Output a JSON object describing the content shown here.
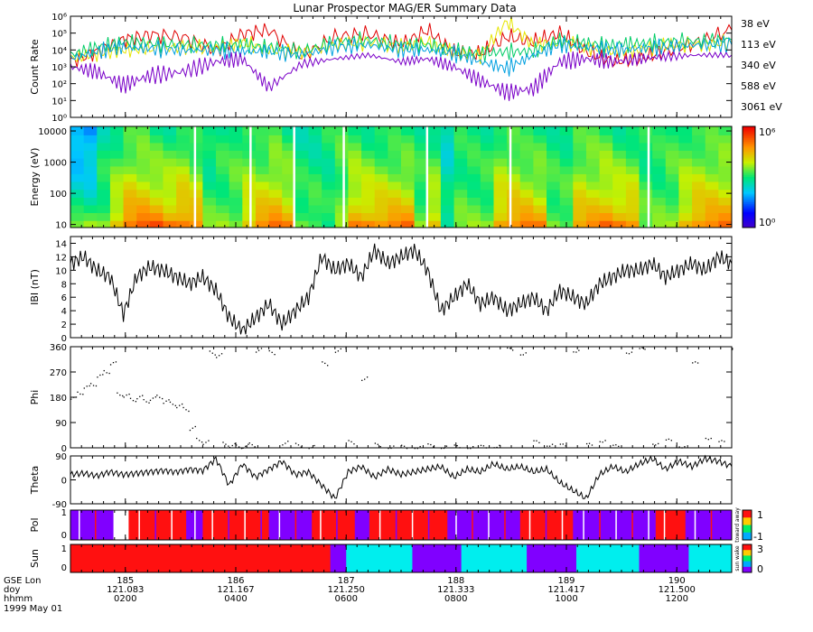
{
  "title": "Lunar Prospector MAG/ER Summary Data",
  "colors": {
    "axis": "#000000",
    "trace": "#000000",
    "ch38": "#e00000",
    "ch113": "#e6e600",
    "ch340": "#00cc66",
    "ch588": "#00a0e0",
    "ch3061": "#7a00c8",
    "pol_pos": "#ff1010",
    "pol_neg": "#8000ff",
    "sun_0": "#ffffff",
    "sun_1": "#8000ff",
    "sun_2": "#00eeee",
    "sun_3": "#ff1010"
  },
  "chart_data": [
    {
      "type": "line",
      "panel": "count-rate",
      "ylabel": "Count Rate",
      "yscale": "log",
      "ylim": [
        1,
        1000000
      ],
      "yticks": [
        "10⁰",
        "10¹",
        "10²",
        "10³",
        "10⁴",
        "10⁵",
        "10⁶"
      ],
      "xlim": [
        0,
        1
      ],
      "series": [
        {
          "name": "38 eV",
          "color": "#e00000",
          "x": [
            0.0,
            0.04,
            0.08,
            0.12,
            0.17,
            0.22,
            0.26,
            0.3,
            0.35,
            0.4,
            0.45,
            0.5,
            0.54,
            0.58,
            0.62,
            0.66,
            0.7,
            0.74,
            0.78,
            0.82,
            0.86,
            0.9,
            0.95,
            1.0
          ],
          "y": [
            2000,
            8000,
            40000,
            80000,
            60000,
            9000,
            90000,
            150000,
            4000,
            60000,
            90000,
            20000,
            150000,
            7000,
            6000,
            60000,
            30000,
            100000,
            8000,
            2000,
            3000,
            8000,
            30000,
            150000
          ]
        },
        {
          "name": "113 eV",
          "color": "#e6e600",
          "x": [
            0.0,
            0.04,
            0.08,
            0.12,
            0.17,
            0.22,
            0.26,
            0.3,
            0.35,
            0.4,
            0.45,
            0.5,
            0.54,
            0.58,
            0.62,
            0.66,
            0.7,
            0.74,
            0.78,
            0.82,
            0.86,
            0.9,
            0.95,
            1.0
          ],
          "y": [
            3000,
            6000,
            10000,
            12000,
            15000,
            12000,
            30000,
            10000,
            8000,
            20000,
            30000,
            15000,
            30000,
            6000,
            5000,
            500000,
            20000,
            30000,
            15000,
            8000,
            10000,
            20000,
            20000,
            30000
          ]
        },
        {
          "name": "340 eV",
          "color": "#00cc66",
          "x": [
            0.0,
            0.04,
            0.08,
            0.12,
            0.17,
            0.22,
            0.26,
            0.3,
            0.35,
            0.4,
            0.45,
            0.5,
            0.54,
            0.58,
            0.62,
            0.66,
            0.7,
            0.74,
            0.78,
            0.82,
            0.86,
            0.9,
            0.95,
            1.0
          ],
          "y": [
            5000,
            15000,
            30000,
            25000,
            20000,
            20000,
            20000,
            15000,
            8000,
            30000,
            40000,
            20000,
            20000,
            10000,
            6000,
            8000,
            8000,
            40000,
            25000,
            20000,
            25000,
            30000,
            35000,
            40000
          ]
        },
        {
          "name": "588 eV",
          "color": "#00a0e0",
          "x": [
            0.0,
            0.04,
            0.08,
            0.12,
            0.17,
            0.22,
            0.26,
            0.3,
            0.35,
            0.4,
            0.45,
            0.5,
            0.54,
            0.58,
            0.62,
            0.66,
            0.7,
            0.74,
            0.78,
            0.82,
            0.86,
            0.9,
            0.95,
            1.0
          ],
          "y": [
            3000,
            8000,
            15000,
            12000,
            10000,
            10000,
            8000,
            8000,
            5000,
            15000,
            20000,
            10000,
            10000,
            6000,
            2000,
            800,
            5000,
            20000,
            15000,
            10000,
            12000,
            15000,
            20000,
            20000
          ]
        },
        {
          "name": "3061 eV",
          "color": "#7a00c8",
          "x": [
            0.0,
            0.04,
            0.08,
            0.12,
            0.17,
            0.22,
            0.26,
            0.3,
            0.35,
            0.4,
            0.45,
            0.5,
            0.54,
            0.58,
            0.62,
            0.66,
            0.7,
            0.74,
            0.78,
            0.82,
            0.86,
            0.9,
            0.95,
            1.0
          ],
          "y": [
            1000,
            500,
            80,
            300,
            500,
            2000,
            3000,
            60,
            1500,
            3000,
            5000,
            2000,
            3000,
            1000,
            150,
            30,
            50,
            2000,
            3000,
            2000,
            3000,
            4000,
            5000,
            5000
          ]
        }
      ]
    },
    {
      "type": "heatmap",
      "panel": "energy-spectrogram",
      "ylabel": "Energy (eV)",
      "yscale": "log",
      "ylim": [
        8,
        14000
      ],
      "yticks": [
        "10",
        "100",
        "1000",
        "10000"
      ],
      "colorbar": {
        "min_label": "10⁰",
        "max_label": "10⁶",
        "zscale": "log",
        "zlim": [
          1,
          1000000
        ]
      },
      "x_segments": [
        0.0,
        0.02,
        0.04,
        0.06,
        0.08,
        0.1,
        0.12,
        0.14,
        0.16,
        0.18,
        0.2,
        0.22,
        0.24,
        0.26,
        0.28,
        0.3,
        0.32,
        0.34,
        0.36,
        0.38,
        0.4,
        0.42,
        0.44,
        0.46,
        0.48,
        0.5,
        0.52,
        0.54,
        0.56,
        0.58,
        0.6,
        0.62,
        0.64,
        0.66,
        0.68,
        0.7,
        0.72,
        0.74,
        0.76,
        0.78,
        0.8,
        0.82,
        0.84,
        0.86,
        0.88,
        0.9,
        0.92,
        0.94,
        0.96,
        0.98
      ],
      "energy_bins": [
        10,
        18,
        32,
        56,
        100,
        180,
        320,
        560,
        1000,
        1800,
        3200,
        5600,
        10000
      ],
      "low_energy_flux_log": [
        3.5,
        3.5,
        3.5,
        4.5,
        5.2,
        5.2,
        5.2,
        5.0,
        5.2,
        5.0,
        3.5,
        3.5,
        3.5,
        4.5,
        5.0,
        5.0,
        4.8,
        3.5,
        3.5,
        3.0,
        3.5,
        4.8,
        5.0,
        5.0,
        5.0,
        5.0,
        3.5,
        4.5,
        3.0,
        3.5,
        3.5,
        3.5,
        4.8,
        5.0,
        5.0,
        4.8,
        3.5,
        3.5,
        4.8,
        4.8,
        5.0,
        5.0,
        5.0,
        3.5,
        3.5,
        3.5,
        4.5,
        5.0,
        5.0,
        5.0
      ],
      "high_energy_flux_log": [
        1.8,
        1.8,
        2.8,
        3.0,
        3.2,
        3.2,
        3.0,
        3.0,
        3.2,
        3.0,
        2.8,
        3.0,
        3.2,
        3.2,
        3.0,
        3.2,
        3.0,
        2.8,
        2.8,
        3.0,
        3.2,
        3.2,
        3.0,
        3.0,
        3.0,
        3.0,
        3.0,
        3.0,
        2.5,
        3.0,
        3.0,
        3.0,
        3.2,
        3.2,
        3.0,
        3.0,
        3.0,
        3.0,
        3.2,
        3.2,
        3.2,
        3.0,
        3.0,
        3.0,
        3.0,
        3.2,
        3.2,
        3.2,
        3.2,
        3.2
      ],
      "data_gaps_x": [
        0.188,
        0.272,
        0.338,
        0.413,
        0.539,
        0.665,
        0.874
      ]
    },
    {
      "type": "line",
      "panel": "field-magnitude",
      "ylabel": "IBI (nT)",
      "ylim": [
        0,
        15
      ],
      "yticks": [
        "0",
        "2",
        "4",
        "6",
        "8",
        "10",
        "12",
        "14"
      ],
      "x": [
        0.0,
        0.02,
        0.04,
        0.06,
        0.08,
        0.1,
        0.12,
        0.14,
        0.16,
        0.18,
        0.2,
        0.22,
        0.24,
        0.26,
        0.28,
        0.3,
        0.32,
        0.34,
        0.36,
        0.38,
        0.4,
        0.42,
        0.44,
        0.46,
        0.48,
        0.5,
        0.52,
        0.54,
        0.56,
        0.58,
        0.6,
        0.62,
        0.64,
        0.66,
        0.68,
        0.7,
        0.72,
        0.74,
        0.76,
        0.78,
        0.8,
        0.82,
        0.84,
        0.86,
        0.88,
        0.9,
        0.92,
        0.94,
        0.96,
        0.98,
        1.0
      ],
      "y": [
        11,
        12,
        10,
        9,
        3.5,
        9,
        10.5,
        10,
        9,
        8,
        9,
        7,
        3,
        1,
        3,
        5,
        2,
        4,
        6,
        12,
        10,
        11,
        9,
        13,
        11,
        12,
        13,
        10,
        4,
        6,
        8,
        5,
        6,
        4,
        5,
        6,
        4,
        7,
        6,
        5,
        8,
        9,
        10,
        10,
        11,
        9,
        10,
        11,
        10,
        12,
        11
      ]
    },
    {
      "type": "scatter",
      "panel": "phi",
      "ylabel": "Phi",
      "ylim": [
        0,
        360
      ],
      "yticks": [
        "0",
        "90",
        "180",
        "270",
        "360"
      ],
      "x": [
        0.0,
        0.01,
        0.02,
        0.03,
        0.04,
        0.05,
        0.06,
        0.07,
        0.08,
        0.09,
        0.1,
        0.11,
        0.12,
        0.13,
        0.14,
        0.15,
        0.16,
        0.17,
        0.18,
        0.19,
        0.2,
        0.21,
        0.22,
        0.23,
        0.24,
        0.25,
        0.26,
        0.27,
        0.28,
        0.3,
        0.32,
        0.34,
        0.36,
        0.38,
        0.4,
        0.42,
        0.44,
        0.46,
        0.48,
        0.5,
        0.52,
        0.54,
        0.56,
        0.58,
        0.6,
        0.62,
        0.64,
        0.66,
        0.68,
        0.7,
        0.72,
        0.74,
        0.76,
        0.78,
        0.8,
        0.82,
        0.84,
        0.86,
        0.88,
        0.9,
        0.92,
        0.94,
        0.96,
        0.98,
        1.0
      ],
      "y": [
        175,
        200,
        215,
        230,
        255,
        275,
        300,
        195,
        185,
        175,
        180,
        170,
        175,
        185,
        165,
        160,
        150,
        140,
        70,
        30,
        20,
        340,
        330,
        15,
        10,
        5,
        8,
        12,
        350,
        340,
        20,
        10,
        5,
        300,
        350,
        20,
        250,
        10,
        5,
        3,
        4,
        8,
        6,
        4,
        5,
        3,
        10,
        350,
        340,
        20,
        15,
        8,
        350,
        10,
        30,
        5,
        345,
        350,
        20,
        25,
        10,
        300,
        40,
        20,
        360
      ]
    },
    {
      "type": "line",
      "panel": "theta",
      "ylabel": "Theta",
      "ylim": [
        -90,
        90
      ],
      "yticks": [
        "-90",
        "0",
        "90"
      ],
      "x": [
        0.0,
        0.02,
        0.04,
        0.06,
        0.08,
        0.1,
        0.12,
        0.14,
        0.16,
        0.18,
        0.2,
        0.22,
        0.24,
        0.26,
        0.28,
        0.3,
        0.32,
        0.34,
        0.36,
        0.38,
        0.4,
        0.42,
        0.44,
        0.46,
        0.48,
        0.5,
        0.52,
        0.54,
        0.56,
        0.58,
        0.6,
        0.62,
        0.64,
        0.66,
        0.68,
        0.7,
        0.72,
        0.74,
        0.76,
        0.78,
        0.8,
        0.82,
        0.84,
        0.86,
        0.88,
        0.9,
        0.92,
        0.94,
        0.96,
        0.98,
        1.0
      ],
      "y": [
        20,
        25,
        15,
        30,
        20,
        25,
        30,
        35,
        30,
        40,
        35,
        80,
        -20,
        60,
        10,
        40,
        70,
        20,
        30,
        -20,
        -70,
        30,
        50,
        10,
        40,
        20,
        30,
        40,
        50,
        10,
        40,
        30,
        60,
        40,
        50,
        30,
        40,
        -10,
        -40,
        -70,
        20,
        50,
        30,
        60,
        80,
        40,
        70,
        50,
        80,
        70,
        50
      ]
    },
    {
      "type": "heatmap",
      "panel": "polarity",
      "ylabel": "Pol",
      "yticks": [
        "0",
        "1"
      ],
      "colorbar": {
        "min_label": "-1",
        "max_label": "1",
        "caption": "toward  away"
      },
      "segments": [
        {
          "x0": 0.0,
          "x1": 0.065,
          "value": -1
        },
        {
          "x0": 0.065,
          "x1": 0.088,
          "value": 0
        },
        {
          "x0": 0.088,
          "x1": 0.175,
          "value": 1
        },
        {
          "x0": 0.175,
          "x1": 0.2,
          "value": -1
        },
        {
          "x0": 0.2,
          "x1": 0.3,
          "value": 1
        },
        {
          "x0": 0.3,
          "x1": 0.365,
          "value": -1
        },
        {
          "x0": 0.365,
          "x1": 0.43,
          "value": 1
        },
        {
          "x0": 0.43,
          "x1": 0.452,
          "value": -1
        },
        {
          "x0": 0.452,
          "x1": 0.57,
          "value": 1
        },
        {
          "x0": 0.57,
          "x1": 0.68,
          "value": -1
        },
        {
          "x0": 0.68,
          "x1": 0.76,
          "value": 1
        },
        {
          "x0": 0.76,
          "x1": 0.885,
          "value": -1
        },
        {
          "x0": 0.885,
          "x1": 0.93,
          "value": 1
        },
        {
          "x0": 0.93,
          "x1": 1.0,
          "value": -1
        }
      ]
    },
    {
      "type": "heatmap",
      "panel": "sun",
      "ylabel": "Sun",
      "yticks": [
        "0",
        "1"
      ],
      "colorbar": {
        "min_label": "0",
        "max_label": "3",
        "caption": "sun  wake"
      },
      "segments": [
        {
          "x0": 0.0,
          "x1": 0.393,
          "value": 3
        },
        {
          "x0": 0.393,
          "x1": 0.417,
          "value": 1
        },
        {
          "x0": 0.417,
          "x1": 0.517,
          "value": 2
        },
        {
          "x0": 0.517,
          "x1": 0.591,
          "value": 1
        },
        {
          "x0": 0.591,
          "x1": 0.69,
          "value": 2
        },
        {
          "x0": 0.69,
          "x1": 0.765,
          "value": 1
        },
        {
          "x0": 0.765,
          "x1": 0.86,
          "value": 2
        },
        {
          "x0": 0.86,
          "x1": 0.935,
          "value": 1
        },
        {
          "x0": 0.935,
          "x1": 1.0,
          "value": 2
        }
      ]
    }
  ],
  "xaxis": {
    "row_labels": [
      "GSE Lon",
      "doy",
      "hhmm",
      "1999 May 01"
    ],
    "ticks": [
      {
        "x": 0.083,
        "gse_lon": "185",
        "doy": "121.083",
        "hhmm": "0200"
      },
      {
        "x": 0.25,
        "gse_lon": "186",
        "doy": "121.167",
        "hhmm": "0400"
      },
      {
        "x": 0.417,
        "gse_lon": "187",
        "doy": "121.250",
        "hhmm": "0600"
      },
      {
        "x": 0.583,
        "gse_lon": "188",
        "doy": "121.333",
        "hhmm": "0800"
      },
      {
        "x": 0.75,
        "gse_lon": "189",
        "doy": "121.417",
        "hhmm": "1000"
      },
      {
        "x": 0.917,
        "gse_lon": "190",
        "doy": "121.500",
        "hhmm": "1200"
      }
    ]
  }
}
